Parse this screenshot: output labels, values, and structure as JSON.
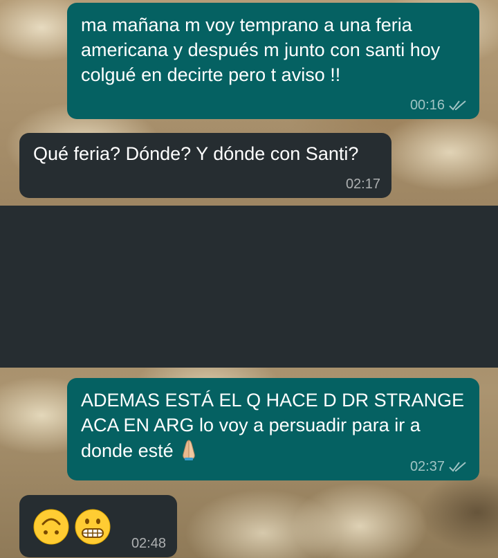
{
  "conversation": {
    "messages": [
      {
        "direction": "outgoing",
        "text": "ma mañana m voy temprano a una feria americana y después m junto con santi hoy colgué en decirte pero t aviso !!",
        "time": "00:16",
        "status": "delivered-double-check"
      },
      {
        "direction": "incoming",
        "text": "Qué feria? Dónde? Y dónde con Santi?",
        "time": "02:17"
      },
      {
        "direction": "outgoing",
        "text": "ADEMAS ESTÁ EL Q HACE D DR STRANGE ACA EN ARG lo voy a persuadir para ir a donde esté",
        "emoji": "folded-hands-emoji",
        "time": "02:37",
        "status": "delivered-double-check"
      },
      {
        "direction": "incoming",
        "emojis": [
          "upside-down-face-emoji",
          "grimacing-face-emoji"
        ],
        "time": "02:48"
      }
    ]
  },
  "colors": {
    "outgoing_bubble": "#056162",
    "incoming_bubble": "#262d31",
    "redaction_block": "#262d31",
    "meta_text": "#b4c3c5"
  },
  "icons": {
    "check": "double-check-icon"
  }
}
